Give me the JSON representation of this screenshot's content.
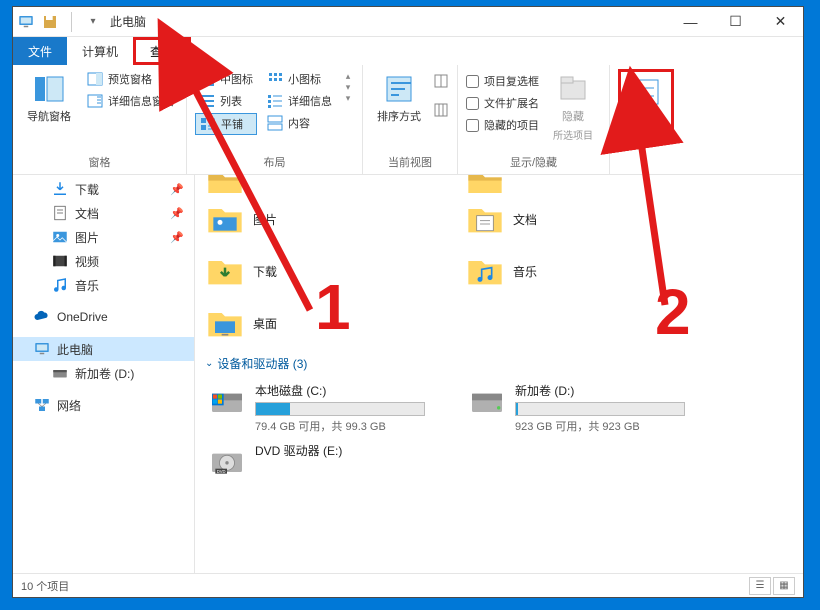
{
  "window": {
    "title": "此电脑"
  },
  "win_controls": {
    "min": "—",
    "max": "☐",
    "close": "✕"
  },
  "tabs": {
    "file": "文件",
    "computer": "计算机",
    "view": "查看"
  },
  "ribbon": {
    "pane": {
      "nav": "导航窗格",
      "preview": "预览窗格",
      "details": "详细信息窗格",
      "group": "窗格"
    },
    "layout": {
      "medium": "中图标",
      "small": "小图标",
      "list": "列表",
      "det": "详细信息",
      "tiles": "平铺",
      "content": "内容",
      "group": "布局"
    },
    "view": {
      "sort": "排序方式",
      "group": "当前视图"
    },
    "showhide": {
      "chk1": "项目复选框",
      "chk2": "文件扩展名",
      "chk3": "隐藏的项目",
      "hide_btn": "隐藏",
      "hide_sub": "所选项目",
      "group": "显示/隐藏"
    },
    "options": {
      "label": "选项"
    }
  },
  "sidebar": {
    "items": [
      {
        "label": "下载",
        "icon": "download",
        "pin": true
      },
      {
        "label": "文档",
        "icon": "doc",
        "pin": true
      },
      {
        "label": "图片",
        "icon": "pic",
        "pin": true
      },
      {
        "label": "视频",
        "icon": "video",
        "pin": false
      },
      {
        "label": "音乐",
        "icon": "music",
        "pin": false
      }
    ],
    "onedrive": "OneDrive",
    "thispc": "此电脑",
    "volume": "新加卷 (D:)",
    "network": "网络"
  },
  "folders": [
    {
      "label": "图片",
      "icon": "pic"
    },
    {
      "label": "文档",
      "icon": "doc"
    },
    {
      "label": "下载",
      "icon": "download"
    },
    {
      "label": "音乐",
      "icon": "music"
    },
    {
      "label": "桌面",
      "icon": "desktop"
    }
  ],
  "drives_header": "设备和驱动器 (3)",
  "drives": [
    {
      "name": "本地磁盘 (C:)",
      "free": "79.4 GB 可用，共 99.3 GB",
      "fill": 20,
      "type": "hdd"
    },
    {
      "name": "新加卷 (D:)",
      "free": "923 GB 可用，共 923 GB",
      "fill": 1,
      "type": "hdd"
    },
    {
      "name": "DVD 驱动器 (E:)",
      "free": "",
      "fill": -1,
      "type": "dvd"
    }
  ],
  "statusbar": {
    "count": "10 个项目"
  },
  "annotations": {
    "one": "1",
    "two": "2"
  }
}
